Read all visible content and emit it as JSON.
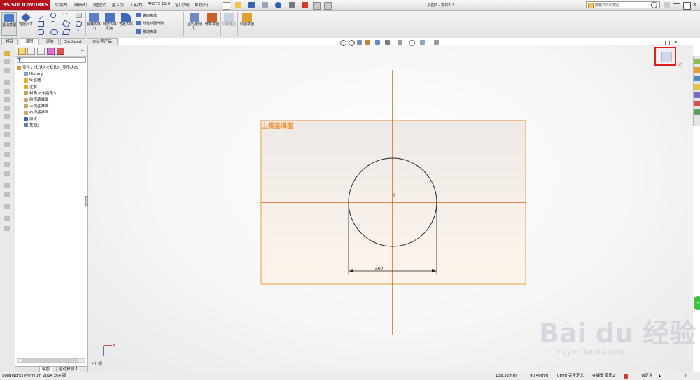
{
  "app": {
    "logo_text": "SOLIDWORKS",
    "logo_prefix": "3S",
    "document_title": "草图2 - 零件1 *"
  },
  "menu": [
    "文件(F)",
    "编辑(E)",
    "视图(V)",
    "插入(I)",
    "工具(T)",
    "ANSYS 15.0",
    "窗口(W)",
    "帮助(H)"
  ],
  "search": {
    "placeholder": "搜索文件和模型"
  },
  "command_manager": {
    "exit_sketch": "退出草图",
    "smart_dimension": "智能尺寸",
    "trim_entities": "剪裁实体(T)",
    "convert_entities": "转换实体引用",
    "offset_entities": "等距实体",
    "mirror_entities": "镜向实体",
    "linear_pattern": "线性草图阵列",
    "move_entities": "移动实体",
    "display_delete_relations": "显示/删除几...",
    "repair_sketch": "修复草图",
    "quick_snaps": "快速捕捉",
    "rapid_sketch": "快速草图"
  },
  "tabs": [
    {
      "label": "特征",
      "active": false
    },
    {
      "label": "草图",
      "active": true
    },
    {
      "label": "评估",
      "active": false
    },
    {
      "label": "DimXpert",
      "active": false
    },
    {
      "label": "办公室产品",
      "active": false
    }
  ],
  "feature_tree": [
    {
      "label": "零件1 (默认<<默认>_显示状态",
      "icon": "part-icon",
      "indent": 0
    },
    {
      "label": "History",
      "icon": "history-icon",
      "indent": 1
    },
    {
      "label": "传感器",
      "icon": "sensor-icon",
      "indent": 1
    },
    {
      "label": "注解",
      "icon": "annotation-icon",
      "indent": 1
    },
    {
      "label": "材质 <未指定>",
      "icon": "material-icon",
      "indent": 1
    },
    {
      "label": "前视基准面",
      "icon": "plane-icon",
      "indent": 1
    },
    {
      "label": "上视基准面",
      "icon": "plane-icon",
      "indent": 1
    },
    {
      "label": "右视基准面",
      "icon": "plane-icon",
      "indent": 1
    },
    {
      "label": "原点",
      "icon": "origin-icon",
      "indent": 1
    },
    {
      "label": "草图2",
      "icon": "sketch-icon",
      "indent": 1
    }
  ],
  "bottom_tabs": [
    "模型",
    "运动算例 1"
  ],
  "graphics": {
    "plane_label": "上视基准面",
    "dimension_text": "⌀60",
    "view_label": "*上视",
    "triad_x": "X"
  },
  "status": {
    "product": "SolidWorks Premium 2014 x64 版",
    "x": "138.32mm",
    "y": "90.46mm",
    "z": "0mm",
    "define_state": "完全定义",
    "editing": "在编辑 草图2",
    "units": "自定义",
    "help_icon": "?"
  },
  "watermark": {
    "text": "Bai du 经验",
    "url": "jingyan.baidu.com"
  },
  "colors": {
    "brand_red": "#b3121d",
    "sketch_orange": "#d2691e",
    "plane_orange": "#ef9b3a",
    "highlight_red": "#e0201a"
  }
}
